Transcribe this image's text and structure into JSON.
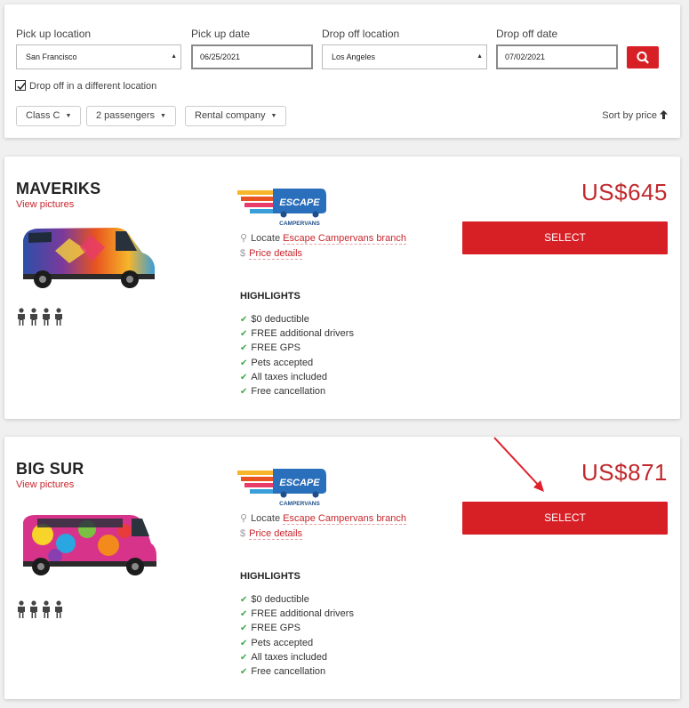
{
  "search": {
    "pickup_location_label": "Pick up location",
    "pickup_location_value": "San Francisco",
    "pickup_date_label": "Pick up date",
    "pickup_date_value": "06/25/2021",
    "dropoff_location_label": "Drop off location",
    "dropoff_location_value": "Los Angeles",
    "dropoff_date_label": "Drop off date",
    "dropoff_date_value": "07/02/2021",
    "different_location_label": "Drop off in a different location",
    "different_location_checked": true,
    "search_icon": "search-icon"
  },
  "filters": {
    "class": "Class C",
    "passengers": "2 passengers",
    "rental_company": "Rental company",
    "sort_label": "Sort by price"
  },
  "accent_color": "#d71f26",
  "listings": [
    {
      "name": "MAVERIKS",
      "view_pictures": "View pictures",
      "brand_top": "ESCAPE",
      "brand_bottom": "CAMPERVANS",
      "locate_prefix": "Locate",
      "locate_link": "Escape Campervans branch",
      "price_details": "Price details",
      "price": "US$645",
      "select_label": "SELECT",
      "highlights_title": "HIGHLIGHTS",
      "highlights": [
        "$0 deductible",
        "FREE additional drivers",
        "FREE GPS",
        "Pets accepted",
        "All taxes included",
        "Free cancellation"
      ],
      "passenger_count": 4
    },
    {
      "name": "BIG SUR",
      "view_pictures": "View pictures",
      "brand_top": "ESCAPE",
      "brand_bottom": "CAMPERVANS",
      "locate_prefix": "Locate",
      "locate_link": "Escape Campervans branch",
      "price_details": "Price details",
      "price": "US$871",
      "select_label": "SELECT",
      "highlights_title": "HIGHLIGHTS",
      "highlights": [
        "$0 deductible",
        "FREE additional drivers",
        "FREE GPS",
        "Pets accepted",
        "All taxes included",
        "Free cancellation"
      ],
      "passenger_count": 4
    }
  ]
}
